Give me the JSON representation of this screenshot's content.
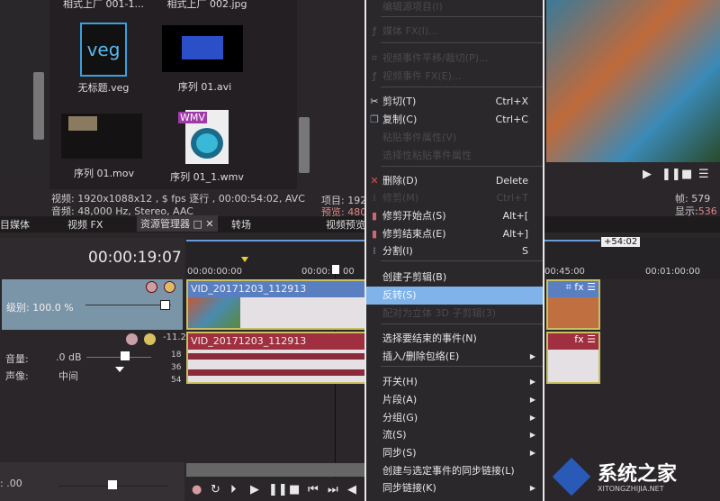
{
  "media": {
    "items": [
      {
        "name": "相式上厂 001-1...",
        "icon": "image-icon"
      },
      {
        "name": "相式上厂 002.jpg",
        "icon": "image-icon"
      },
      {
        "name": "无标题.veg",
        "icon": "veg-file-icon",
        "badge": "veg"
      },
      {
        "name": "序列 01.avi",
        "icon": "video-thumbnail"
      },
      {
        "name": "序列 01.mov",
        "icon": "video-thumbnail"
      },
      {
        "name": "序列 01_1.wmv",
        "icon": "wmv-file-icon",
        "badge": "WMV"
      }
    ],
    "video_info": "视频: 1920x1088x12 , $ fps 逐行 , 00:00:54:02, AVC",
    "audio_info": "音频: 48,000 Hz, Stereo, AAC"
  },
  "tabs": [
    "目媒体",
    "视频 FX",
    "资源管理器",
    "转场",
    "视频预览"
  ],
  "preview": {
    "project": "项目: 192",
    "preview": "预览: 480",
    "frame_label": "帧:",
    "frame_value": "579",
    "display_label": "显示:",
    "display_value": "536"
  },
  "timeline": {
    "timecode": "00:00:19:07",
    "ruler": [
      "00:00:00:00",
      "00:00:",
      "00",
      "00:45:00",
      "00:01:00:00"
    ],
    "end_marker": "+54:02",
    "video_track": {
      "level": "级别: 100.0 %",
      "clip": "VID_20171203_112913"
    },
    "audio_track": {
      "volume_label": "音量:",
      "volume": ".0 dB",
      "pan_label": "声像:",
      "pan": "中间",
      "meter": [
        "-11.2",
        "18",
        "36",
        "54"
      ],
      "clip": "VID_20171203_112913"
    },
    "rate": ": .00"
  },
  "context_menu": {
    "items": [
      {
        "label": "编辑源项目(I)",
        "disabled": true
      },
      {
        "label": "媒体 FX(I)...",
        "disabled": true
      },
      {
        "label": "视频事件平移/裁切(P)...",
        "disabled": true
      },
      {
        "label": "视频事件 FX(E)...",
        "disabled": true
      },
      {
        "label": "剪切(T)",
        "shortcut": "Ctrl+X"
      },
      {
        "label": "复制(C)",
        "shortcut": "Ctrl+C"
      },
      {
        "label": "粘贴事件属性(V)",
        "disabled": true
      },
      {
        "label": "选择性粘贴事件属性",
        "disabled": true
      },
      {
        "label": "删除(D)",
        "shortcut": "Delete"
      },
      {
        "label": "修剪(M)",
        "shortcut": "Ctrl+T",
        "disabled": true
      },
      {
        "label": "修剪开始点(S)",
        "shortcut": "Alt+["
      },
      {
        "label": "修剪结束点(E)",
        "shortcut": "Alt+]"
      },
      {
        "label": "分割(I)",
        "shortcut": "S"
      },
      {
        "label": "创建子剪辑(B)"
      },
      {
        "label": "反转(S)",
        "highlighted": true
      },
      {
        "label": "配对为立体 3D 子剪辑(3)",
        "disabled": true
      },
      {
        "label": "选择要结束的事件(N)"
      },
      {
        "label": "插入/删除包络(E)",
        "submenu": true
      },
      {
        "label": "开关(H)",
        "submenu": true
      },
      {
        "label": "片段(A)",
        "submenu": true
      },
      {
        "label": "分组(G)",
        "submenu": true
      },
      {
        "label": "流(S)",
        "submenu": true
      },
      {
        "label": "同步(S)",
        "submenu": true
      },
      {
        "label": "创建与选定事件的同步链接(L)"
      },
      {
        "label": "同步链接(K)",
        "submenu": true
      }
    ]
  },
  "watermark": "系统之家",
  "watermark_url": "XITONGZHIJIA.NET",
  "colors": {
    "highlight": "#7fb3ea",
    "video_clip": "#5a7fc0",
    "audio_clip": "#a0303f",
    "track_header": "#7b95a8"
  }
}
